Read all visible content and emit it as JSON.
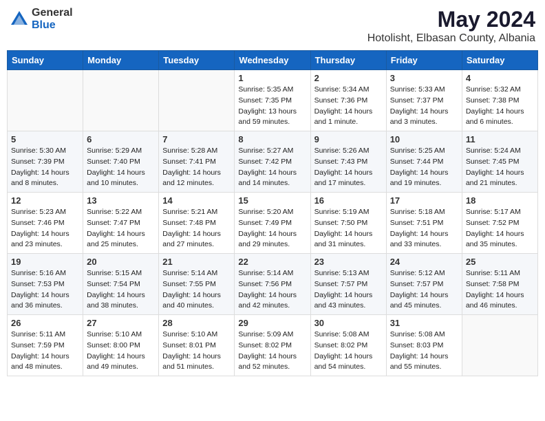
{
  "header": {
    "logo_general": "General",
    "logo_blue": "Blue",
    "month_title": "May 2024",
    "location": "Hotolisht, Elbasan County, Albania"
  },
  "days_of_week": [
    "Sunday",
    "Monday",
    "Tuesday",
    "Wednesday",
    "Thursday",
    "Friday",
    "Saturday"
  ],
  "weeks": [
    [
      {
        "day": "",
        "sunrise": "",
        "sunset": "",
        "daylight": ""
      },
      {
        "day": "",
        "sunrise": "",
        "sunset": "",
        "daylight": ""
      },
      {
        "day": "",
        "sunrise": "",
        "sunset": "",
        "daylight": ""
      },
      {
        "day": "1",
        "sunrise": "Sunrise: 5:35 AM",
        "sunset": "Sunset: 7:35 PM",
        "daylight": "Daylight: 13 hours and 59 minutes."
      },
      {
        "day": "2",
        "sunrise": "Sunrise: 5:34 AM",
        "sunset": "Sunset: 7:36 PM",
        "daylight": "Daylight: 14 hours and 1 minute."
      },
      {
        "day": "3",
        "sunrise": "Sunrise: 5:33 AM",
        "sunset": "Sunset: 7:37 PM",
        "daylight": "Daylight: 14 hours and 3 minutes."
      },
      {
        "day": "4",
        "sunrise": "Sunrise: 5:32 AM",
        "sunset": "Sunset: 7:38 PM",
        "daylight": "Daylight: 14 hours and 6 minutes."
      }
    ],
    [
      {
        "day": "5",
        "sunrise": "Sunrise: 5:30 AM",
        "sunset": "Sunset: 7:39 PM",
        "daylight": "Daylight: 14 hours and 8 minutes."
      },
      {
        "day": "6",
        "sunrise": "Sunrise: 5:29 AM",
        "sunset": "Sunset: 7:40 PM",
        "daylight": "Daylight: 14 hours and 10 minutes."
      },
      {
        "day": "7",
        "sunrise": "Sunrise: 5:28 AM",
        "sunset": "Sunset: 7:41 PM",
        "daylight": "Daylight: 14 hours and 12 minutes."
      },
      {
        "day": "8",
        "sunrise": "Sunrise: 5:27 AM",
        "sunset": "Sunset: 7:42 PM",
        "daylight": "Daylight: 14 hours and 14 minutes."
      },
      {
        "day": "9",
        "sunrise": "Sunrise: 5:26 AM",
        "sunset": "Sunset: 7:43 PM",
        "daylight": "Daylight: 14 hours and 17 minutes."
      },
      {
        "day": "10",
        "sunrise": "Sunrise: 5:25 AM",
        "sunset": "Sunset: 7:44 PM",
        "daylight": "Daylight: 14 hours and 19 minutes."
      },
      {
        "day": "11",
        "sunrise": "Sunrise: 5:24 AM",
        "sunset": "Sunset: 7:45 PM",
        "daylight": "Daylight: 14 hours and 21 minutes."
      }
    ],
    [
      {
        "day": "12",
        "sunrise": "Sunrise: 5:23 AM",
        "sunset": "Sunset: 7:46 PM",
        "daylight": "Daylight: 14 hours and 23 minutes."
      },
      {
        "day": "13",
        "sunrise": "Sunrise: 5:22 AM",
        "sunset": "Sunset: 7:47 PM",
        "daylight": "Daylight: 14 hours and 25 minutes."
      },
      {
        "day": "14",
        "sunrise": "Sunrise: 5:21 AM",
        "sunset": "Sunset: 7:48 PM",
        "daylight": "Daylight: 14 hours and 27 minutes."
      },
      {
        "day": "15",
        "sunrise": "Sunrise: 5:20 AM",
        "sunset": "Sunset: 7:49 PM",
        "daylight": "Daylight: 14 hours and 29 minutes."
      },
      {
        "day": "16",
        "sunrise": "Sunrise: 5:19 AM",
        "sunset": "Sunset: 7:50 PM",
        "daylight": "Daylight: 14 hours and 31 minutes."
      },
      {
        "day": "17",
        "sunrise": "Sunrise: 5:18 AM",
        "sunset": "Sunset: 7:51 PM",
        "daylight": "Daylight: 14 hours and 33 minutes."
      },
      {
        "day": "18",
        "sunrise": "Sunrise: 5:17 AM",
        "sunset": "Sunset: 7:52 PM",
        "daylight": "Daylight: 14 hours and 35 minutes."
      }
    ],
    [
      {
        "day": "19",
        "sunrise": "Sunrise: 5:16 AM",
        "sunset": "Sunset: 7:53 PM",
        "daylight": "Daylight: 14 hours and 36 minutes."
      },
      {
        "day": "20",
        "sunrise": "Sunrise: 5:15 AM",
        "sunset": "Sunset: 7:54 PM",
        "daylight": "Daylight: 14 hours and 38 minutes."
      },
      {
        "day": "21",
        "sunrise": "Sunrise: 5:14 AM",
        "sunset": "Sunset: 7:55 PM",
        "daylight": "Daylight: 14 hours and 40 minutes."
      },
      {
        "day": "22",
        "sunrise": "Sunrise: 5:14 AM",
        "sunset": "Sunset: 7:56 PM",
        "daylight": "Daylight: 14 hours and 42 minutes."
      },
      {
        "day": "23",
        "sunrise": "Sunrise: 5:13 AM",
        "sunset": "Sunset: 7:57 PM",
        "daylight": "Daylight: 14 hours and 43 minutes."
      },
      {
        "day": "24",
        "sunrise": "Sunrise: 5:12 AM",
        "sunset": "Sunset: 7:57 PM",
        "daylight": "Daylight: 14 hours and 45 minutes."
      },
      {
        "day": "25",
        "sunrise": "Sunrise: 5:11 AM",
        "sunset": "Sunset: 7:58 PM",
        "daylight": "Daylight: 14 hours and 46 minutes."
      }
    ],
    [
      {
        "day": "26",
        "sunrise": "Sunrise: 5:11 AM",
        "sunset": "Sunset: 7:59 PM",
        "daylight": "Daylight: 14 hours and 48 minutes."
      },
      {
        "day": "27",
        "sunrise": "Sunrise: 5:10 AM",
        "sunset": "Sunset: 8:00 PM",
        "daylight": "Daylight: 14 hours and 49 minutes."
      },
      {
        "day": "28",
        "sunrise": "Sunrise: 5:10 AM",
        "sunset": "Sunset: 8:01 PM",
        "daylight": "Daylight: 14 hours and 51 minutes."
      },
      {
        "day": "29",
        "sunrise": "Sunrise: 5:09 AM",
        "sunset": "Sunset: 8:02 PM",
        "daylight": "Daylight: 14 hours and 52 minutes."
      },
      {
        "day": "30",
        "sunrise": "Sunrise: 5:08 AM",
        "sunset": "Sunset: 8:02 PM",
        "daylight": "Daylight: 14 hours and 54 minutes."
      },
      {
        "day": "31",
        "sunrise": "Sunrise: 5:08 AM",
        "sunset": "Sunset: 8:03 PM",
        "daylight": "Daylight: 14 hours and 55 minutes."
      },
      {
        "day": "",
        "sunrise": "",
        "sunset": "",
        "daylight": ""
      }
    ]
  ]
}
